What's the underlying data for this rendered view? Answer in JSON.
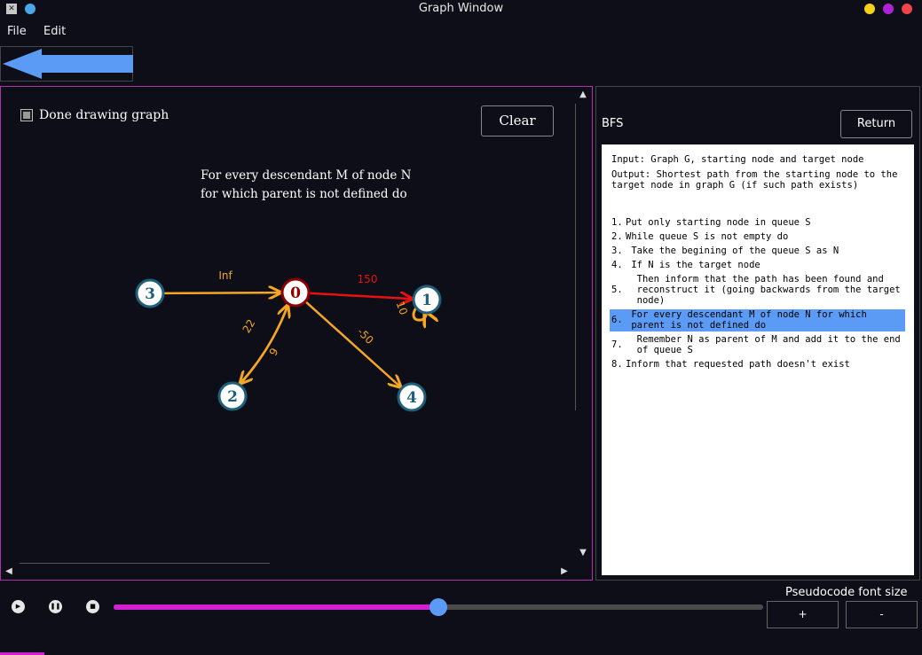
{
  "window": {
    "title": "Graph Window"
  },
  "titlebar_colors": {
    "yellow": "#f5d11c",
    "purple": "#b020d8",
    "red": "#f0444a",
    "app_dot": "#4aa8e8"
  },
  "menu": {
    "file": "File",
    "edit": "Edit"
  },
  "controls": {
    "done_drawing_label": "Done drawing graph",
    "done_drawing_checked": true,
    "clear_label": "Clear"
  },
  "current_step_text": [
    "For every descendant M of node N",
    "for which parent is not defined do"
  ],
  "graph": {
    "nodes": [
      {
        "id": "0",
        "state": "current"
      },
      {
        "id": "1",
        "state": "normal"
      },
      {
        "id": "2",
        "state": "normal"
      },
      {
        "id": "3",
        "state": "normal"
      },
      {
        "id": "4",
        "state": "normal"
      }
    ],
    "edges": [
      {
        "from": "3",
        "to": "0",
        "weight": "Inf",
        "color": "#f5a623"
      },
      {
        "from": "0",
        "to": "1",
        "weight": "150",
        "color": "#e81010"
      },
      {
        "from": "1",
        "to": "1",
        "weight": "10",
        "color": "#f5a623"
      },
      {
        "from": "0",
        "to": "2",
        "weight": "22",
        "color": "#f5a623"
      },
      {
        "from": "2",
        "to": "0",
        "weight": "9",
        "color": "#f5a623"
      },
      {
        "from": "0",
        "to": "4",
        "weight": "-50",
        "color": "#f5a623"
      }
    ]
  },
  "pseudocode_panel": {
    "algorithm": "BFS",
    "return_label": "Return",
    "input_text": "Input: Graph G, starting node and target node",
    "output_line1": "Output: Shortest path from the starting node to the",
    "output_line2": "target node in graph G (if such path exists)",
    "lines": [
      {
        "num": "1.",
        "text": [
          "Put only starting node in queue S"
        ]
      },
      {
        "num": "2.",
        "text": [
          "While queue S is not empty do"
        ]
      },
      {
        "num": "3.",
        "text": [
          " Take the begining of the queue S as N"
        ]
      },
      {
        "num": "4.",
        "text": [
          " If N is the target node"
        ]
      },
      {
        "num": "5.",
        "text": [
          "  Then inform that the path has been found and",
          "  reconstruct it (going backwards from the target",
          "  node)"
        ]
      },
      {
        "num": "6.",
        "text": [
          " For every descendant M of node N for which",
          " parent is not defined do"
        ],
        "highlighted": true
      },
      {
        "num": "7.",
        "text": [
          "  Remember N as parent of M and add it to the end",
          "  of queue S"
        ]
      },
      {
        "num": "8.",
        "text": [
          "Inform that requested path doesn't exist"
        ]
      }
    ],
    "highlight_color": "#5b9bf5"
  },
  "font_size": {
    "label": "Pseudocode font size",
    "plus": "+",
    "minus": "-"
  },
  "playback": {
    "play_icon": "play-icon",
    "pause_icon": "pause-icon",
    "stop_icon": "stop-icon",
    "progress": 0.5
  },
  "colors": {
    "accent": "#d21fd2",
    "knob": "#5b9bf5",
    "node_fill": "#ffffff",
    "node_border": "#1f5f7a",
    "current_border": "#8b0000"
  }
}
